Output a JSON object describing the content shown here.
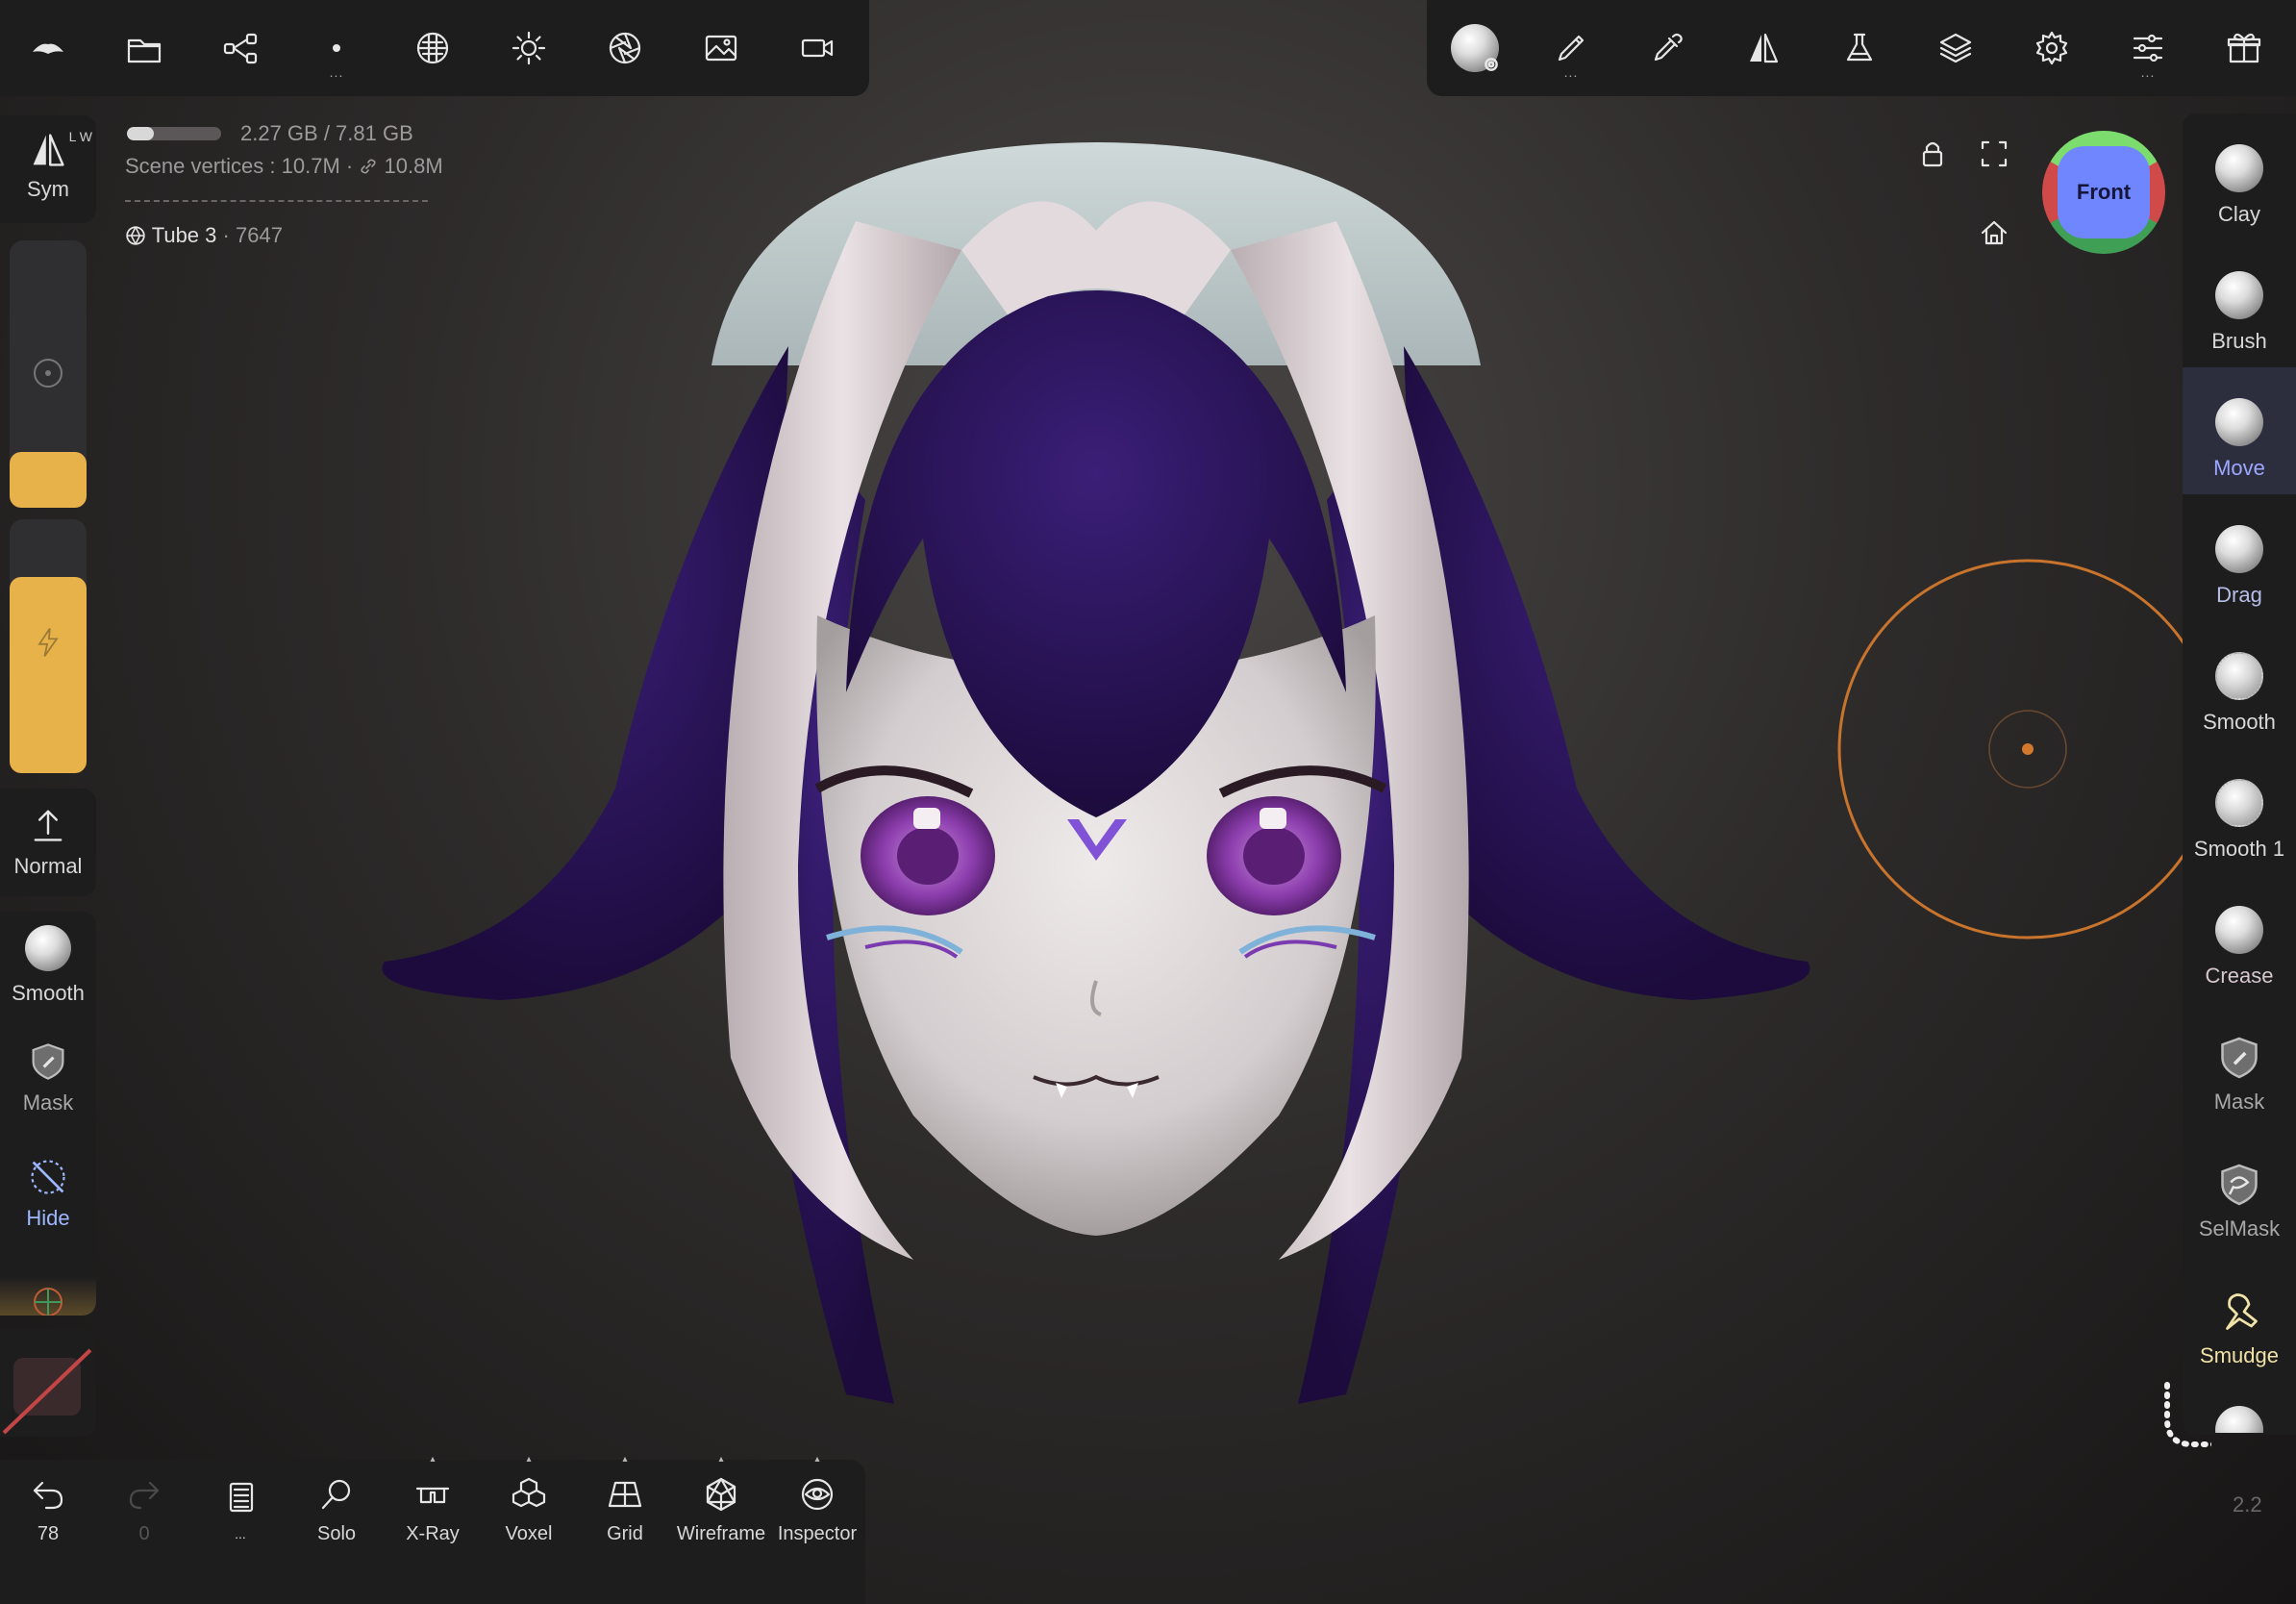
{
  "info": {
    "memory": "2.27 GB / 7.81 GB",
    "vertices_label": "Scene vertices :",
    "vertices_value": "10.7M",
    "vertices_link": "10.8M",
    "object_name": "Tube 3",
    "object_count": "7647",
    "memory_fraction": 0.29
  },
  "gizmo": {
    "view": "Front"
  },
  "left_tools": {
    "sym": "Sym",
    "sym_badge": "L W",
    "normal": "Normal",
    "smooth": "Smooth",
    "mask": "Mask",
    "hide": "Hide"
  },
  "right_tools": [
    {
      "label": "Clay"
    },
    {
      "label": "Brush"
    },
    {
      "label": "Move"
    },
    {
      "label": "Drag"
    },
    {
      "label": "Smooth"
    },
    {
      "label": "Smooth 1"
    },
    {
      "label": "Crease"
    },
    {
      "label": "Mask"
    },
    {
      "label": "SelMask"
    },
    {
      "label": "Smudge"
    }
  ],
  "bottom": {
    "undo_count": "78",
    "redo_count": "0",
    "more": "...",
    "solo": "Solo",
    "xray": "X-Ray",
    "voxel": "Voxel",
    "grid": "Grid",
    "wireframe": "Wireframe",
    "inspector": "Inspector"
  },
  "version": "2.2",
  "colors": {
    "accent": "#e8b24a",
    "panel": "#1e1d1e",
    "hair": "#2d1560",
    "skin": "#d9d3d4",
    "brush_ring": "#c8742c",
    "selected_tool": "#2c2e3e",
    "selected_text": "#9ea7ff"
  }
}
